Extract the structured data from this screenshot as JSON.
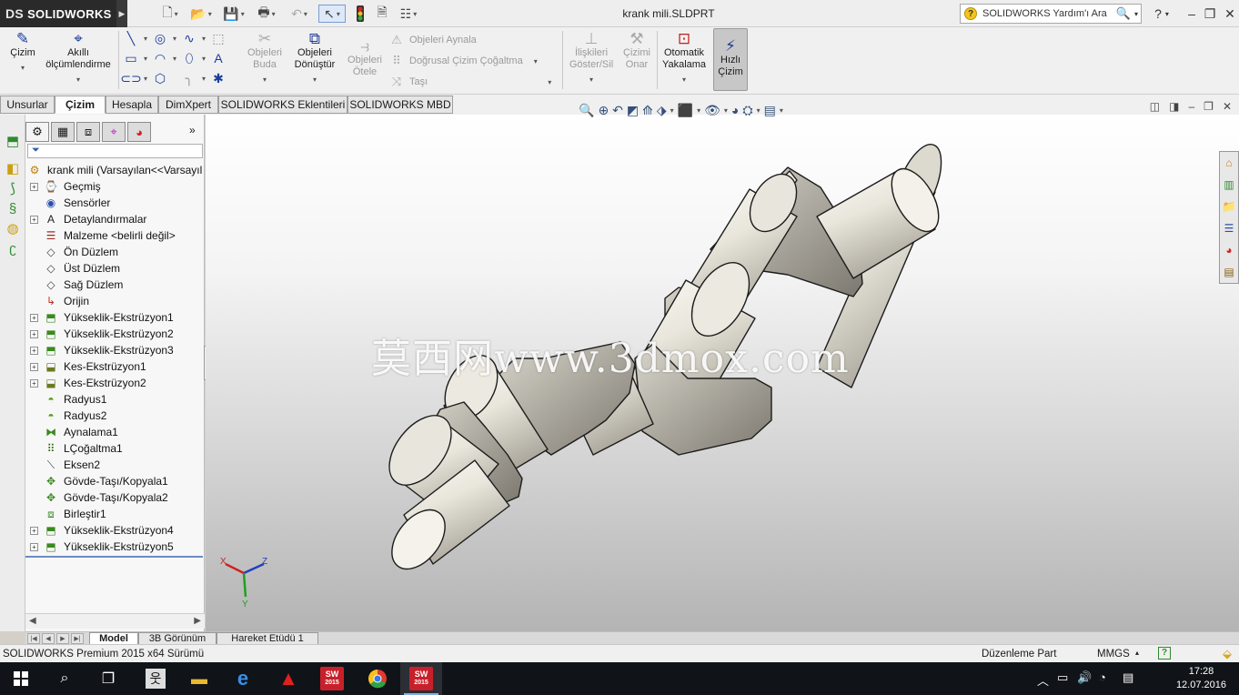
{
  "app": {
    "brand": "SOLIDWORKS",
    "brand_prefix": "DS",
    "document_title": "krank mili.SLDPRT"
  },
  "help": {
    "placeholder": "SOLIDWORKS Yardım'ı Ara"
  },
  "command_manager": {
    "cizim": "Çizim",
    "akilli": "Akıllı ölçümlendirme",
    "objeleri_buda": "Objeleri Buda",
    "objeleri_donustur": "Objeleri Dönüştür",
    "objeleri_otele": "Objeleri Ötele",
    "objeleri_aynala": "Objeleri Aynala",
    "dogrusal": "Doğrusal Çizim Çoğaltma",
    "tasi": "Taşı",
    "iliskileri": "İlişkileri Göster/Sil",
    "cizimi_onar": "Çizimi Onar",
    "otomatik": "Otomatik Yakalama",
    "hizli": "Hızlı Çizim"
  },
  "tabs": [
    "Unsurlar",
    "Çizim",
    "Hesapla",
    "DimXpert",
    "SOLIDWORKS Eklentileri",
    "SOLIDWORKS MBD"
  ],
  "active_tab": "Çizim",
  "tree": {
    "root": "krank mili  (Varsayılan<<Varsayıl",
    "items": [
      {
        "label": "Geçmiş",
        "icon": "history-icon",
        "expandable": true
      },
      {
        "label": "Sensörler",
        "icon": "sensor-icon",
        "expandable": false
      },
      {
        "label": "Detaylandırmalar",
        "icon": "annotation-icon",
        "expandable": true
      },
      {
        "label": "Malzeme <belirli değil>",
        "icon": "material-icon",
        "expandable": false
      },
      {
        "label": "Ön Düzlem",
        "icon": "plane-icon",
        "expandable": false
      },
      {
        "label": "Üst Düzlem",
        "icon": "plane-icon",
        "expandable": false
      },
      {
        "label": "Sağ Düzlem",
        "icon": "plane-icon",
        "expandable": false
      },
      {
        "label": "Orijin",
        "icon": "origin-icon",
        "expandable": false
      },
      {
        "label": "Yükseklik-Ekstrüzyon1",
        "icon": "boss-extrude-icon",
        "expandable": true
      },
      {
        "label": "Yükseklik-Ekstrüzyon2",
        "icon": "boss-extrude-icon",
        "expandable": true
      },
      {
        "label": "Yükseklik-Ekstrüzyon3",
        "icon": "boss-extrude-icon",
        "expandable": true
      },
      {
        "label": "Kes-Ekstrüzyon1",
        "icon": "cut-extrude-icon",
        "expandable": true
      },
      {
        "label": "Kes-Ekstrüzyon2",
        "icon": "cut-extrude-icon",
        "expandable": true
      },
      {
        "label": "Radyus1",
        "icon": "fillet-icon",
        "expandable": false
      },
      {
        "label": "Radyus2",
        "icon": "fillet-icon",
        "expandable": false
      },
      {
        "label": "Aynalama1",
        "icon": "mirror-icon",
        "expandable": false
      },
      {
        "label": "LÇoğaltma1",
        "icon": "pattern-icon",
        "expandable": false
      },
      {
        "label": "Eksen2",
        "icon": "axis-icon",
        "expandable": false
      },
      {
        "label": "Gövde-Taşı/Kopyala1",
        "icon": "move-body-icon",
        "expandable": false
      },
      {
        "label": "Gövde-Taşı/Kopyala2",
        "icon": "move-body-icon",
        "expandable": false
      },
      {
        "label": "Birleştir1",
        "icon": "combine-icon",
        "expandable": false
      },
      {
        "label": "Yükseklik-Ekstrüzyon4",
        "icon": "boss-extrude-icon",
        "expandable": true
      },
      {
        "label": "Yükseklik-Ekstrüzyon5",
        "icon": "boss-extrude-icon",
        "expandable": true
      }
    ]
  },
  "watermark": "莫西网www.3dmox.com",
  "triad": {
    "x": "X",
    "y": "Y",
    "z": "Z"
  },
  "bottom_tabs": [
    "Model",
    "3B Görünüm",
    "Hareket Etüdü 1"
  ],
  "status": {
    "left": "SOLIDWORKS Premium 2015 x64 Sürümü",
    "mode": "Düzenleme Part",
    "units": "MMGS"
  },
  "taskbar": {
    "sw_year": "2015",
    "time": "17:28",
    "date": "12.07.2016"
  },
  "colors": {
    "accent": "#1c3d9a",
    "sw_red": "#c8202a",
    "taskbar": "#101418"
  }
}
